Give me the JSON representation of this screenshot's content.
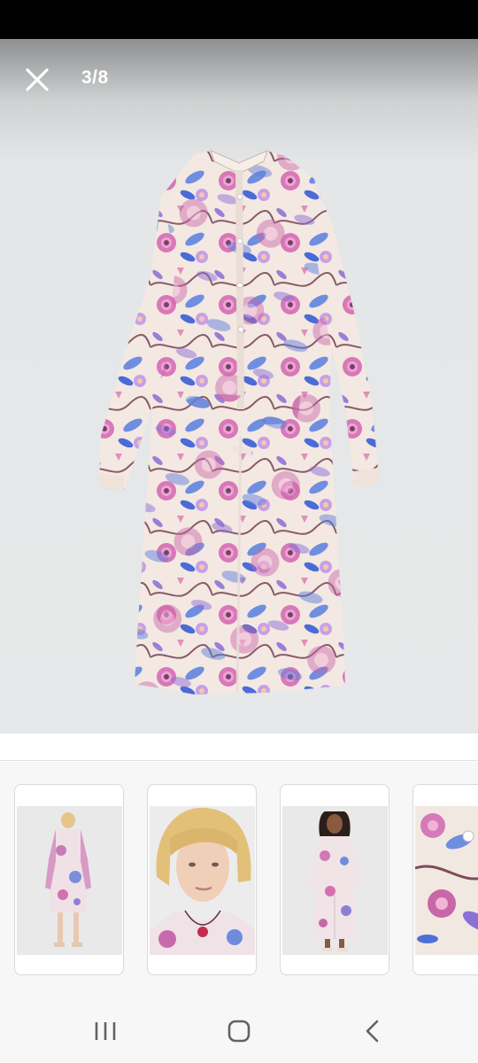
{
  "viewer": {
    "counter": "3/8",
    "current_index": 3,
    "total_images": 8
  },
  "icons": {
    "close": "close-icon",
    "recents": "recents-icon",
    "home": "home-icon",
    "back": "back-icon"
  },
  "colors": {
    "status_bar": "#000000",
    "gallery_background": "#e6e8e9",
    "thumb_border": "#d9d9d9",
    "nav_icon": "#5f6368"
  },
  "thumbnails": [
    {
      "name": "thumb-back-view"
    },
    {
      "name": "thumb-model-closeup"
    },
    {
      "name": "thumb-model-front"
    },
    {
      "name": "thumb-fabric-detail"
    }
  ]
}
